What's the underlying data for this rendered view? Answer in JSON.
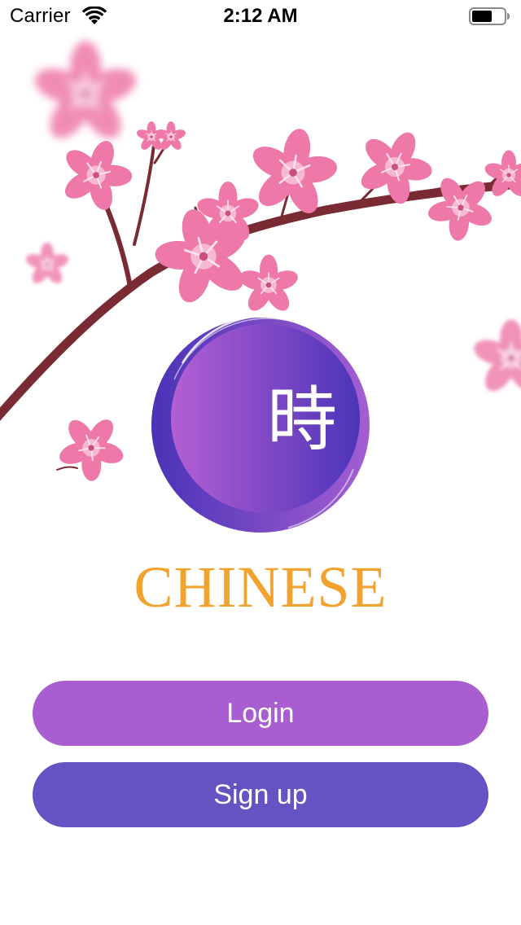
{
  "status_bar": {
    "carrier": "Carrier",
    "time": "2:12 AM",
    "wifi_icon": "wifi-icon",
    "battery_icon": "battery-icon"
  },
  "logo": {
    "character": "時",
    "title": "CHINESE",
    "emblem_icon": "purple-brush-circle-icon",
    "title_color": "#F2A22E"
  },
  "buttons": {
    "login_label": "Login",
    "signup_label": "Sign up",
    "login_color": "#A85ED0",
    "signup_color": "#6752C3"
  },
  "illustration": {
    "icon": "cherry-blossom-branch-icon",
    "blossom_color": "#EE78A8",
    "branch_color": "#7A2A33"
  }
}
